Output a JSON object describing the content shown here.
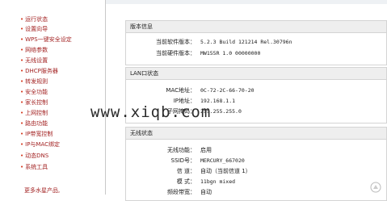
{
  "sidebar": {
    "items": [
      {
        "label": "运行状态"
      },
      {
        "label": "设置向导"
      },
      {
        "label": "WPS一键安全设定"
      },
      {
        "label": "网络参数"
      },
      {
        "label": "无线设置"
      },
      {
        "label": "DHCP服务器"
      },
      {
        "label": "转发规则"
      },
      {
        "label": "安全功能"
      },
      {
        "label": "家长控制"
      },
      {
        "label": "上网控制"
      },
      {
        "label": "路由功能"
      },
      {
        "label": "IP带宽控制"
      },
      {
        "label": "IP与MAC绑定"
      },
      {
        "label": "动态DNS"
      },
      {
        "label": "系统工具"
      }
    ],
    "bullet": "•",
    "more_label": "更多水星产品,"
  },
  "version_panel": {
    "title": "版本信息",
    "rows": [
      {
        "label": "当前软件版本：",
        "value": "5.2.3 Build 121214 Rel.30796n"
      },
      {
        "label": "当前硬件版本：",
        "value": "MW155R 1.0 00000000"
      }
    ]
  },
  "lan_panel": {
    "title": "LAN口状态",
    "rows": [
      {
        "label": "MAC地址：",
        "value": "0C-72-2C-66-70-20"
      },
      {
        "label": "IP地址：",
        "value": "192.168.1.1"
      },
      {
        "label": "子网掩码：",
        "value": "255.255.255.0"
      }
    ]
  },
  "wireless_panel": {
    "title": "无线状态",
    "rows": [
      {
        "label": "无线功能：",
        "value": "启用"
      },
      {
        "label": "SSID号：",
        "value": "MERCURY_667020"
      },
      {
        "label": "信  道：",
        "value": "自动（当前信道 1）"
      },
      {
        "label": "模  式：",
        "value": "11bgn mixed"
      },
      {
        "label": "频段带宽：",
        "value": "自动"
      }
    ]
  },
  "watermark": "www.xiqb.com",
  "colors": {
    "menu_text": "#a32323",
    "bullet": "#d4341b",
    "panel_header": "#eeeeee"
  }
}
